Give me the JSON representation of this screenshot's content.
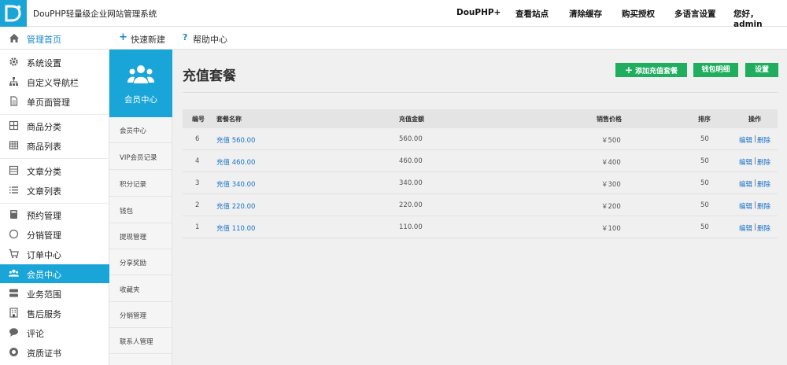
{
  "app": {
    "title": "DouPHP轻量级企业网站管理系统"
  },
  "topnav": [
    "DouPHP+",
    "查看站点",
    "清除缓存",
    "购买授权",
    "多语言设置",
    "您好，admin"
  ],
  "subbar": {
    "home": "管理首页",
    "quick_new": "快速新建",
    "help": "帮助中心"
  },
  "sidebar": {
    "items": [
      {
        "label": "系统设置",
        "icon": "gear-icon"
      },
      {
        "label": "自定义导航栏",
        "icon": "sitemap-icon"
      },
      {
        "label": "单页面管理",
        "icon": "page-icon"
      },
      {
        "label": "商品分类",
        "icon": "grid-icon"
      },
      {
        "label": "商品列表",
        "icon": "table-icon"
      },
      {
        "label": "文章分类",
        "icon": "grid-icon"
      },
      {
        "label": "文章列表",
        "icon": "list-icon"
      },
      {
        "label": "预约管理",
        "icon": "book-icon"
      },
      {
        "label": "分销管理",
        "icon": "circle-icon"
      },
      {
        "label": "订单中心",
        "icon": "cart-icon"
      },
      {
        "label": "会员中心",
        "icon": "users-icon"
      },
      {
        "label": "业务范围",
        "icon": "server-icon"
      },
      {
        "label": "售后服务",
        "icon": "building-icon"
      },
      {
        "label": "评论",
        "icon": "comment-icon"
      },
      {
        "label": "资质证书",
        "icon": "certificate-icon"
      }
    ],
    "active": "会员中心"
  },
  "subside": {
    "header": "会员中心",
    "items": [
      "会员中心",
      "VIP会员记录",
      "积分记录",
      "钱包",
      "提现管理",
      "分享奖励",
      "收藏夹",
      "分销管理",
      "联系人管理"
    ]
  },
  "main": {
    "title": "充值套餐",
    "buttons": {
      "add": "添加充值套餐",
      "wallet": "钱包明细",
      "settings": "设置"
    },
    "columns": [
      "编号",
      "套餐名称",
      "充值金额",
      "销售价格",
      "排序",
      "操作"
    ],
    "rows": [
      {
        "id": "6",
        "name": "充值 560.00",
        "amount": "560.00",
        "price": "￥500",
        "sort": "50"
      },
      {
        "id": "4",
        "name": "充值 460.00",
        "amount": "460.00",
        "price": "￥400",
        "sort": "50"
      },
      {
        "id": "3",
        "name": "充值 340.00",
        "amount": "340.00",
        "price": "￥300",
        "sort": "50"
      },
      {
        "id": "2",
        "name": "充值 220.00",
        "amount": "220.00",
        "price": "￥200",
        "sort": "50"
      },
      {
        "id": "1",
        "name": "充值 110.00",
        "amount": "110.00",
        "price": "￥100",
        "sort": "50"
      }
    ],
    "actions": {
      "edit": "编辑",
      "sep": "|",
      "delete": "删除"
    }
  },
  "colors": {
    "accent": "#1aa5d8",
    "button_green": "#1fae5e",
    "link": "#1a73c8"
  }
}
